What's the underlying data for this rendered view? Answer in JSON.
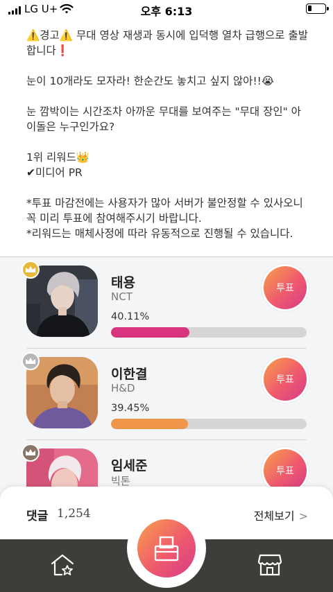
{
  "status_bar": {
    "carrier": "LG U+",
    "time": "오후 6:13"
  },
  "intro": {
    "warning_text": "⚠️경고⚠️ 무대 영상 재생과 동시에 입덕행 열차 급행으로 출발합니다❗",
    "line2": "눈이 10개라도 모자라! 한순간도 놓치고 싶지 않아!!😭",
    "line3": "눈 깜박이는 시간조차 아까운 무대를 보여주는 \"무대 장인\" 아이돌은 누구인가요?",
    "reward_line": "1위 리워드👑",
    "reward_check": "✔",
    "reward_item": "미디어 PR",
    "note1": "*투표 마감전에는 사용자가 많아 서버가 불안정할 수 있사오니 꼭 미리 투표에 참여해주시기 바랍니다.",
    "note2": "*리워드는 매체사정에 따라 유동적으로 진행될 수 있습니다."
  },
  "ranking": [
    {
      "name": "태용",
      "group": "NCT",
      "percent_label": "40.11%",
      "percent": 40.11,
      "vote_label": "투표",
      "crown": "gold-crown",
      "crown_color": "#e8b93c",
      "bar_color": "#d9347e"
    },
    {
      "name": "이한결",
      "group": "H&D",
      "percent_label": "39.45%",
      "percent": 39.45,
      "vote_label": "투표",
      "crown": "silver-crown",
      "crown_color": "#b7b7b7",
      "bar_color": "#f0964a"
    },
    {
      "name": "임세준",
      "group": "빅톤",
      "percent_label": "",
      "percent": 0,
      "vote_label": "투표",
      "crown": "bronze-crown",
      "crown_color": "#8a7666",
      "bar_color": "#f0964a"
    }
  ],
  "comments": {
    "title": "댓글",
    "count": "1,254",
    "see_all": "전체보기",
    "see_all_chevron": ">"
  },
  "colors": {
    "accent_gradient_start": "#f8a04c",
    "accent_gradient_mid": "#ef5a6d",
    "accent_gradient_end": "#d63a8a",
    "nav_background": "#3f3d3a"
  },
  "nav": {
    "left_icon": "home-star-icon",
    "center_icon": "ballot-box-icon",
    "right_icon": "shop-icon"
  }
}
